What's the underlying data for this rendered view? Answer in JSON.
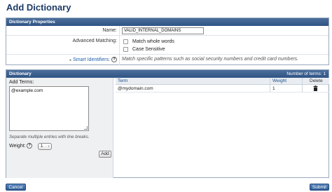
{
  "page": {
    "title": "Add Dictionary"
  },
  "properties": {
    "header": "Dictionary Properties",
    "name_label": "Name:",
    "name_value": "VALID_INTERNAL_DOMAINS",
    "matching_label": "Advanced Matching:",
    "options": [
      {
        "label": "Match whole words",
        "checked": false
      },
      {
        "label": "Case Sensitive",
        "checked": false
      }
    ],
    "smart_identifiers_label": "Smart Identifiers:",
    "smart_identifiers_help": "?",
    "smart_identifiers_desc": "Match specific patterns such as social security numbers and credit card numbers."
  },
  "dictionary": {
    "header": "Dictionary",
    "terms_count_text": "Number of terms: 1",
    "add_terms_label": "Add Terms:",
    "add_terms_value": "@example.com",
    "hint": "Separate multiple entries with line breaks.",
    "weight_label": "Weight:",
    "weight_help": "?",
    "weight_value": "1",
    "add_button": "Add",
    "columns": {
      "term": "Term",
      "weight": "Weight",
      "delete": "Delete"
    },
    "rows": [
      {
        "term": "@mydomain.com",
        "weight": "1"
      }
    ]
  },
  "footer": {
    "cancel": "Cancel",
    "submit": "Submit"
  },
  "icons": {
    "delete": "trash-icon",
    "help": "help-icon",
    "expand": "triangle-right-icon"
  }
}
